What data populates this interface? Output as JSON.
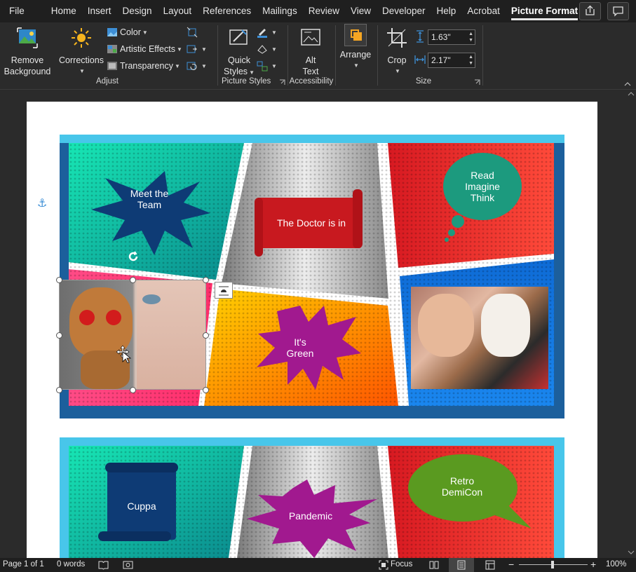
{
  "menu": {
    "tabs": [
      "File",
      "Home",
      "Insert",
      "Design",
      "Layout",
      "References",
      "Mailings",
      "Review",
      "View",
      "Developer",
      "Help",
      "Acrobat",
      "Picture Format"
    ],
    "active_tab": "Picture Format"
  },
  "ribbon": {
    "remove_background": [
      "Remove",
      "Background"
    ],
    "corrections": "Corrections",
    "color": "Color",
    "artistic_effects": "Artistic Effects",
    "transparency": "Transparency",
    "adjust_label": "Adjust",
    "quick_styles": [
      "Quick",
      "Styles"
    ],
    "picture_styles_label": "Picture Styles",
    "alt_text": [
      "Alt",
      "Text"
    ],
    "accessibility_label": "Accessibility",
    "arrange": "Arrange",
    "crop": "Crop",
    "height_value": "1.63\"",
    "width_value": "2.17\"",
    "size_label": "Size"
  },
  "comic1": {
    "burst1": [
      "Meet the",
      "Team"
    ],
    "scroll1": "The Doctor is in",
    "cloud1": [
      "Read",
      "Imagine",
      "Think"
    ],
    "burst2": [
      "It's",
      "Green"
    ]
  },
  "comic2": {
    "scroll": "Cuppa",
    "burst": "Pandemic",
    "bubble": [
      "Retro",
      "DemiCon"
    ]
  },
  "status": {
    "page": "Page 1 of 1",
    "words": "0 words",
    "focus": "Focus",
    "zoom": "100%"
  },
  "colors": {
    "accent": "#3d8fd6",
    "ribbon_bg": "#2b2b2b",
    "menubar_bg": "#1f1f1f"
  }
}
